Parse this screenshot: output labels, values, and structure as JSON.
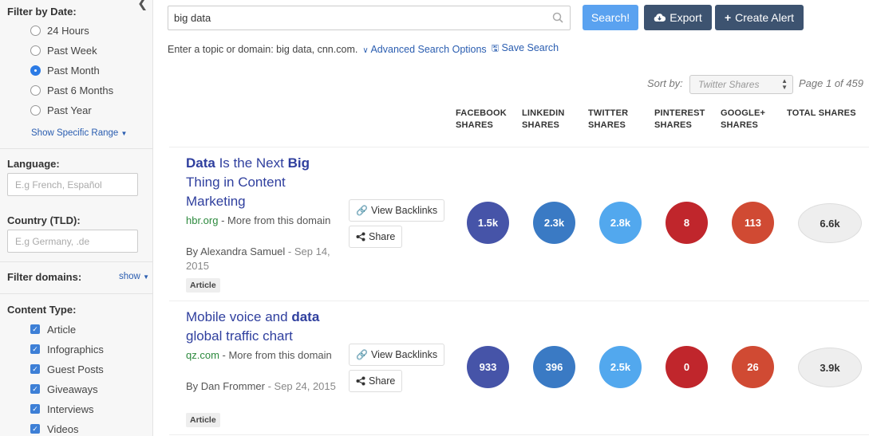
{
  "colors": {
    "facebook": "#4654a8",
    "linkedin": "#3a7ac4",
    "twitter": "#52a8ee",
    "pinterest": "#c0262c",
    "googleplus": "#d04a33",
    "primary_button": "#5aa2f0",
    "dark_button": "#3d5370",
    "link": "#2a5db0",
    "domain_green": "#2d8a3e"
  },
  "sidebar": {
    "date_title": "Filter by Date:",
    "date_options": [
      {
        "label": "24 Hours",
        "checked": false
      },
      {
        "label": "Past Week",
        "checked": false
      },
      {
        "label": "Past Month",
        "checked": true
      },
      {
        "label": "Past 6 Months",
        "checked": false
      },
      {
        "label": "Past Year",
        "checked": false
      }
    ],
    "specific_range": "Show Specific Range",
    "language_title": "Language:",
    "language_placeholder": "E.g French, Español",
    "country_title": "Country (TLD):",
    "country_placeholder": "E.g Germany, .de",
    "domains_title": "Filter domains:",
    "domains_show": "show",
    "content_title": "Content Type:",
    "content_types": [
      {
        "label": "Article",
        "checked": true
      },
      {
        "label": "Infographics",
        "checked": true
      },
      {
        "label": "Guest Posts",
        "checked": true
      },
      {
        "label": "Giveaways",
        "checked": true
      },
      {
        "label": "Interviews",
        "checked": true
      },
      {
        "label": "Videos",
        "checked": true
      }
    ]
  },
  "search": {
    "value": "big data",
    "search_label": "Search!",
    "export_label": "Export",
    "alert_label": "Create Alert",
    "hint": "Enter a topic or domain: big data, cnn.com.",
    "advanced": "Advanced Search Options",
    "save": "Save Search"
  },
  "sort": {
    "label": "Sort by:",
    "value": "Twitter Shares",
    "page": "Page 1 of 459"
  },
  "columns": [
    {
      "line1": "FACEBOOK",
      "line2": "SHARES"
    },
    {
      "line1": "LINKEDIN",
      "line2": "SHARES"
    },
    {
      "line1": "TWITTER",
      "line2": "SHARES"
    },
    {
      "line1": "PINTEREST",
      "line2": "SHARES"
    },
    {
      "line1": "GOOGLE+",
      "line2": "SHARES"
    },
    {
      "line1": "TOTAL SHARES",
      "line2": ""
    }
  ],
  "results": [
    {
      "title_parts": [
        {
          "text": "Data",
          "bold": true
        },
        {
          "text": " Is the Next ",
          "bold": false
        },
        {
          "text": "Big",
          "bold": true
        },
        {
          "text": " Thing in Content Marketing",
          "bold": false
        }
      ],
      "domain": "hbr.org",
      "domain_suffix": " - More from this domain",
      "author": "By Alexandra Samuel",
      "date": " - Sep 14, 2015",
      "badge": "Article",
      "backlinks_label": "View Backlinks",
      "share_label": "Share",
      "facebook": "1.5k",
      "linkedin": "2.3k",
      "twitter": "2.8k",
      "pinterest": "8",
      "googleplus": "113",
      "total": "6.6k"
    },
    {
      "title_parts": [
        {
          "text": "Mobile voice and ",
          "bold": false
        },
        {
          "text": "data",
          "bold": true
        },
        {
          "text": " global traffic chart",
          "bold": false
        }
      ],
      "domain": "qz.com",
      "domain_suffix": " - More from this domain",
      "author": "By Dan Frommer",
      "date": " - Sep 24, 2015",
      "badge": "Article",
      "backlinks_label": "View Backlinks",
      "share_label": "Share",
      "facebook": "933",
      "linkedin": "396",
      "twitter": "2.5k",
      "pinterest": "0",
      "googleplus": "26",
      "total": "3.9k"
    }
  ]
}
